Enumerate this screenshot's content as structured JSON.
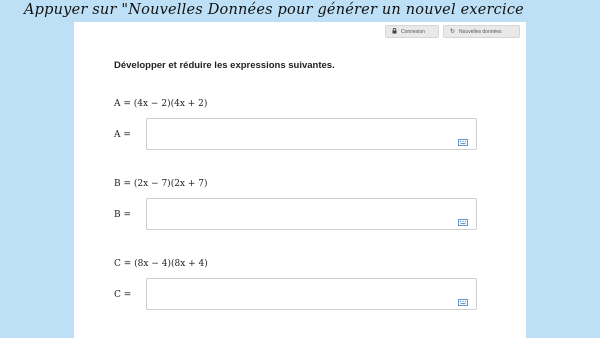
{
  "banner": {
    "text": "Appuyer sur \"Nouvelles Données pour générer un nouvel exercice"
  },
  "toolbar": {
    "connexion_label": "Connexion",
    "nouvelles_label": "Nouvelles données",
    "connexion_icon": "lock-icon",
    "nouvelles_icon": "refresh-icon"
  },
  "exercise": {
    "instruction": "Développer et réduire les expressions suivantes.",
    "items": [
      {
        "expression": "A = (4x − 2)(4x + 2)",
        "answer_label": "A ="
      },
      {
        "expression": "B = (2x − 7)(2x + 7)",
        "answer_label": "B ="
      },
      {
        "expression": "C = (8x − 4)(8x + 4)",
        "answer_label": "C ="
      }
    ],
    "input_icon": "keyboard-icon"
  },
  "colors": {
    "background": "#bde0f6",
    "sheet": "#ffffff",
    "keyboard_icon": "#3b7dbf"
  }
}
